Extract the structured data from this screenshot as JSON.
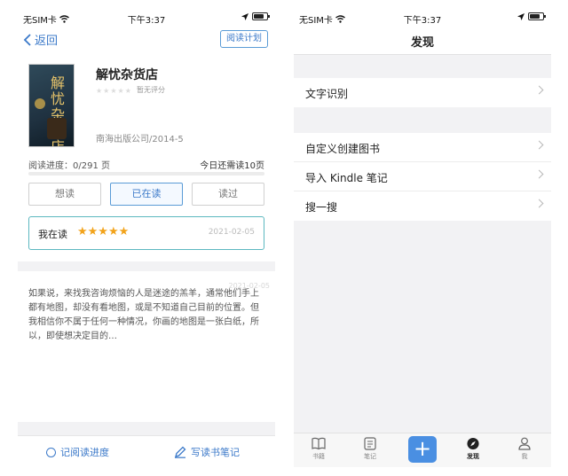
{
  "status_bar": {
    "carrier": "无SIM卡",
    "time": "下午3:37"
  },
  "left": {
    "nav": {
      "back_label": "返回",
      "plan_label": "阅读计划"
    },
    "book": {
      "cover_text": "解忧杂货店",
      "title": "解忧杂货店",
      "rating_text": "暂无评分",
      "publisher": "南海出版公司/2014-5"
    },
    "progress": {
      "label": "阅读进度：0/291 页",
      "today": "今日还需读10页",
      "fraction": 0
    },
    "status_buttons": {
      "want": "想读",
      "reading": "已在读",
      "read": "读过"
    },
    "reading_box": {
      "label": "我在读",
      "stars": 5,
      "date": "2021-02-05"
    },
    "excerpt": {
      "date": "2021-02-05",
      "text": "如果说，来找我咨询烦恼的人是迷途的羔羊，通常他们手上都有地图，却没有看地图，或是不知道自己目前的位置。但我相信你不属于任何一种情况，你画的地图是一张白纸，所以，即使想决定目的…"
    },
    "bottom": {
      "progress_label": "记阅读进度",
      "note_label": "写读书笔记"
    }
  },
  "right": {
    "title": "发现",
    "group1": [
      "文字识别"
    ],
    "group2": [
      "自定义创建图书",
      "导入 Kindle 笔记",
      "搜一搜"
    ],
    "tabs": [
      {
        "label": "书籍",
        "icon": "book-icon"
      },
      {
        "label": "笔记",
        "icon": "note-icon"
      },
      {
        "label": "",
        "icon": "plus-icon"
      },
      {
        "label": "发现",
        "icon": "compass-icon"
      },
      {
        "label": "我",
        "icon": "person-icon"
      }
    ]
  }
}
